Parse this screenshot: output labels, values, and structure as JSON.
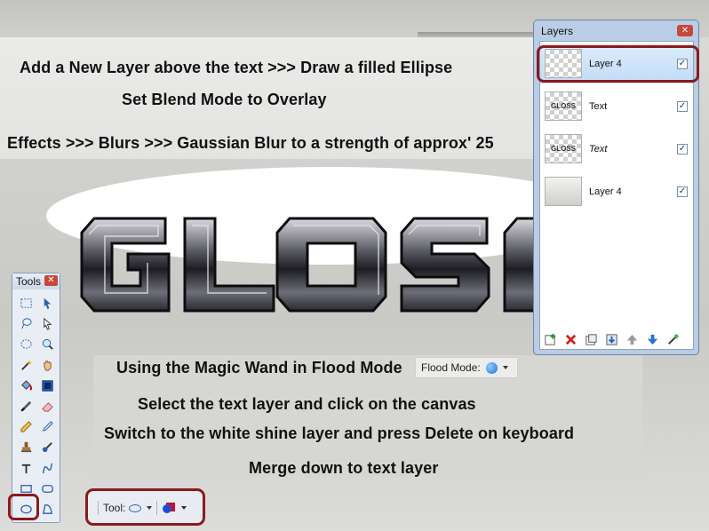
{
  "instructions": {
    "line1": "Add a New Layer above the text >>> Draw a filled Ellipse",
    "line2": "Set Blend Mode to Overlay",
    "line3": "Effects >>> Blurs >>> Gaussian Blur to a strength of approx' 25",
    "line4": "Using the Magic Wand in Flood Mode",
    "line5": "Select the text layer and click on the canvas",
    "line6": "Switch to the white shine layer and press Delete on keyboard",
    "line7": "Merge down to text layer"
  },
  "canvas": {
    "text": "GLOSS"
  },
  "flood_mode": {
    "label": "Flood Mode:",
    "icon": "globe-icon"
  },
  "tools_window": {
    "title": "Tools",
    "close": "✕",
    "tools": [
      "rectangle-select-icon",
      "move-selection-icon",
      "lasso-select-icon",
      "move-selected-icon",
      "ellipse-select-icon",
      "zoom-icon",
      "magic-wand-icon",
      "pan-icon",
      "paint-bucket-icon",
      "gradient-icon",
      "paintbrush-icon",
      "eraser-icon",
      "pencil-icon",
      "color-picker-icon",
      "clone-stamp-icon",
      "recolor-icon",
      "text-icon",
      "line-curve-icon",
      "rectangle-icon",
      "rounded-rectangle-icon",
      "ellipse-icon",
      "freeform-shape-icon"
    ]
  },
  "toolbar": {
    "tool_label": "Tool:"
  },
  "layers_window": {
    "title": "Layers",
    "close": "✕",
    "layers": [
      {
        "name": "Layer 4",
        "thumb": "",
        "checked": "✓",
        "italic": false,
        "selected": true
      },
      {
        "name": "Text",
        "thumb": "GLOSS",
        "checked": "✓",
        "italic": false,
        "selected": false
      },
      {
        "name": "Text",
        "thumb": "GLOSS",
        "checked": "✓",
        "italic": true,
        "selected": false
      },
      {
        "name": "Layer 4",
        "thumb": "",
        "checked": "✓",
        "italic": false,
        "selected": false
      }
    ],
    "buttons": [
      "add-layer-icon",
      "delete-layer-icon",
      "duplicate-layer-icon",
      "merge-down-icon",
      "move-up-icon",
      "move-down-icon",
      "layer-properties-icon"
    ]
  },
  "colors": {
    "highlight": "#8b1a1a",
    "close_button": "#c8473a",
    "selected_layer": "#c2dcf6"
  }
}
